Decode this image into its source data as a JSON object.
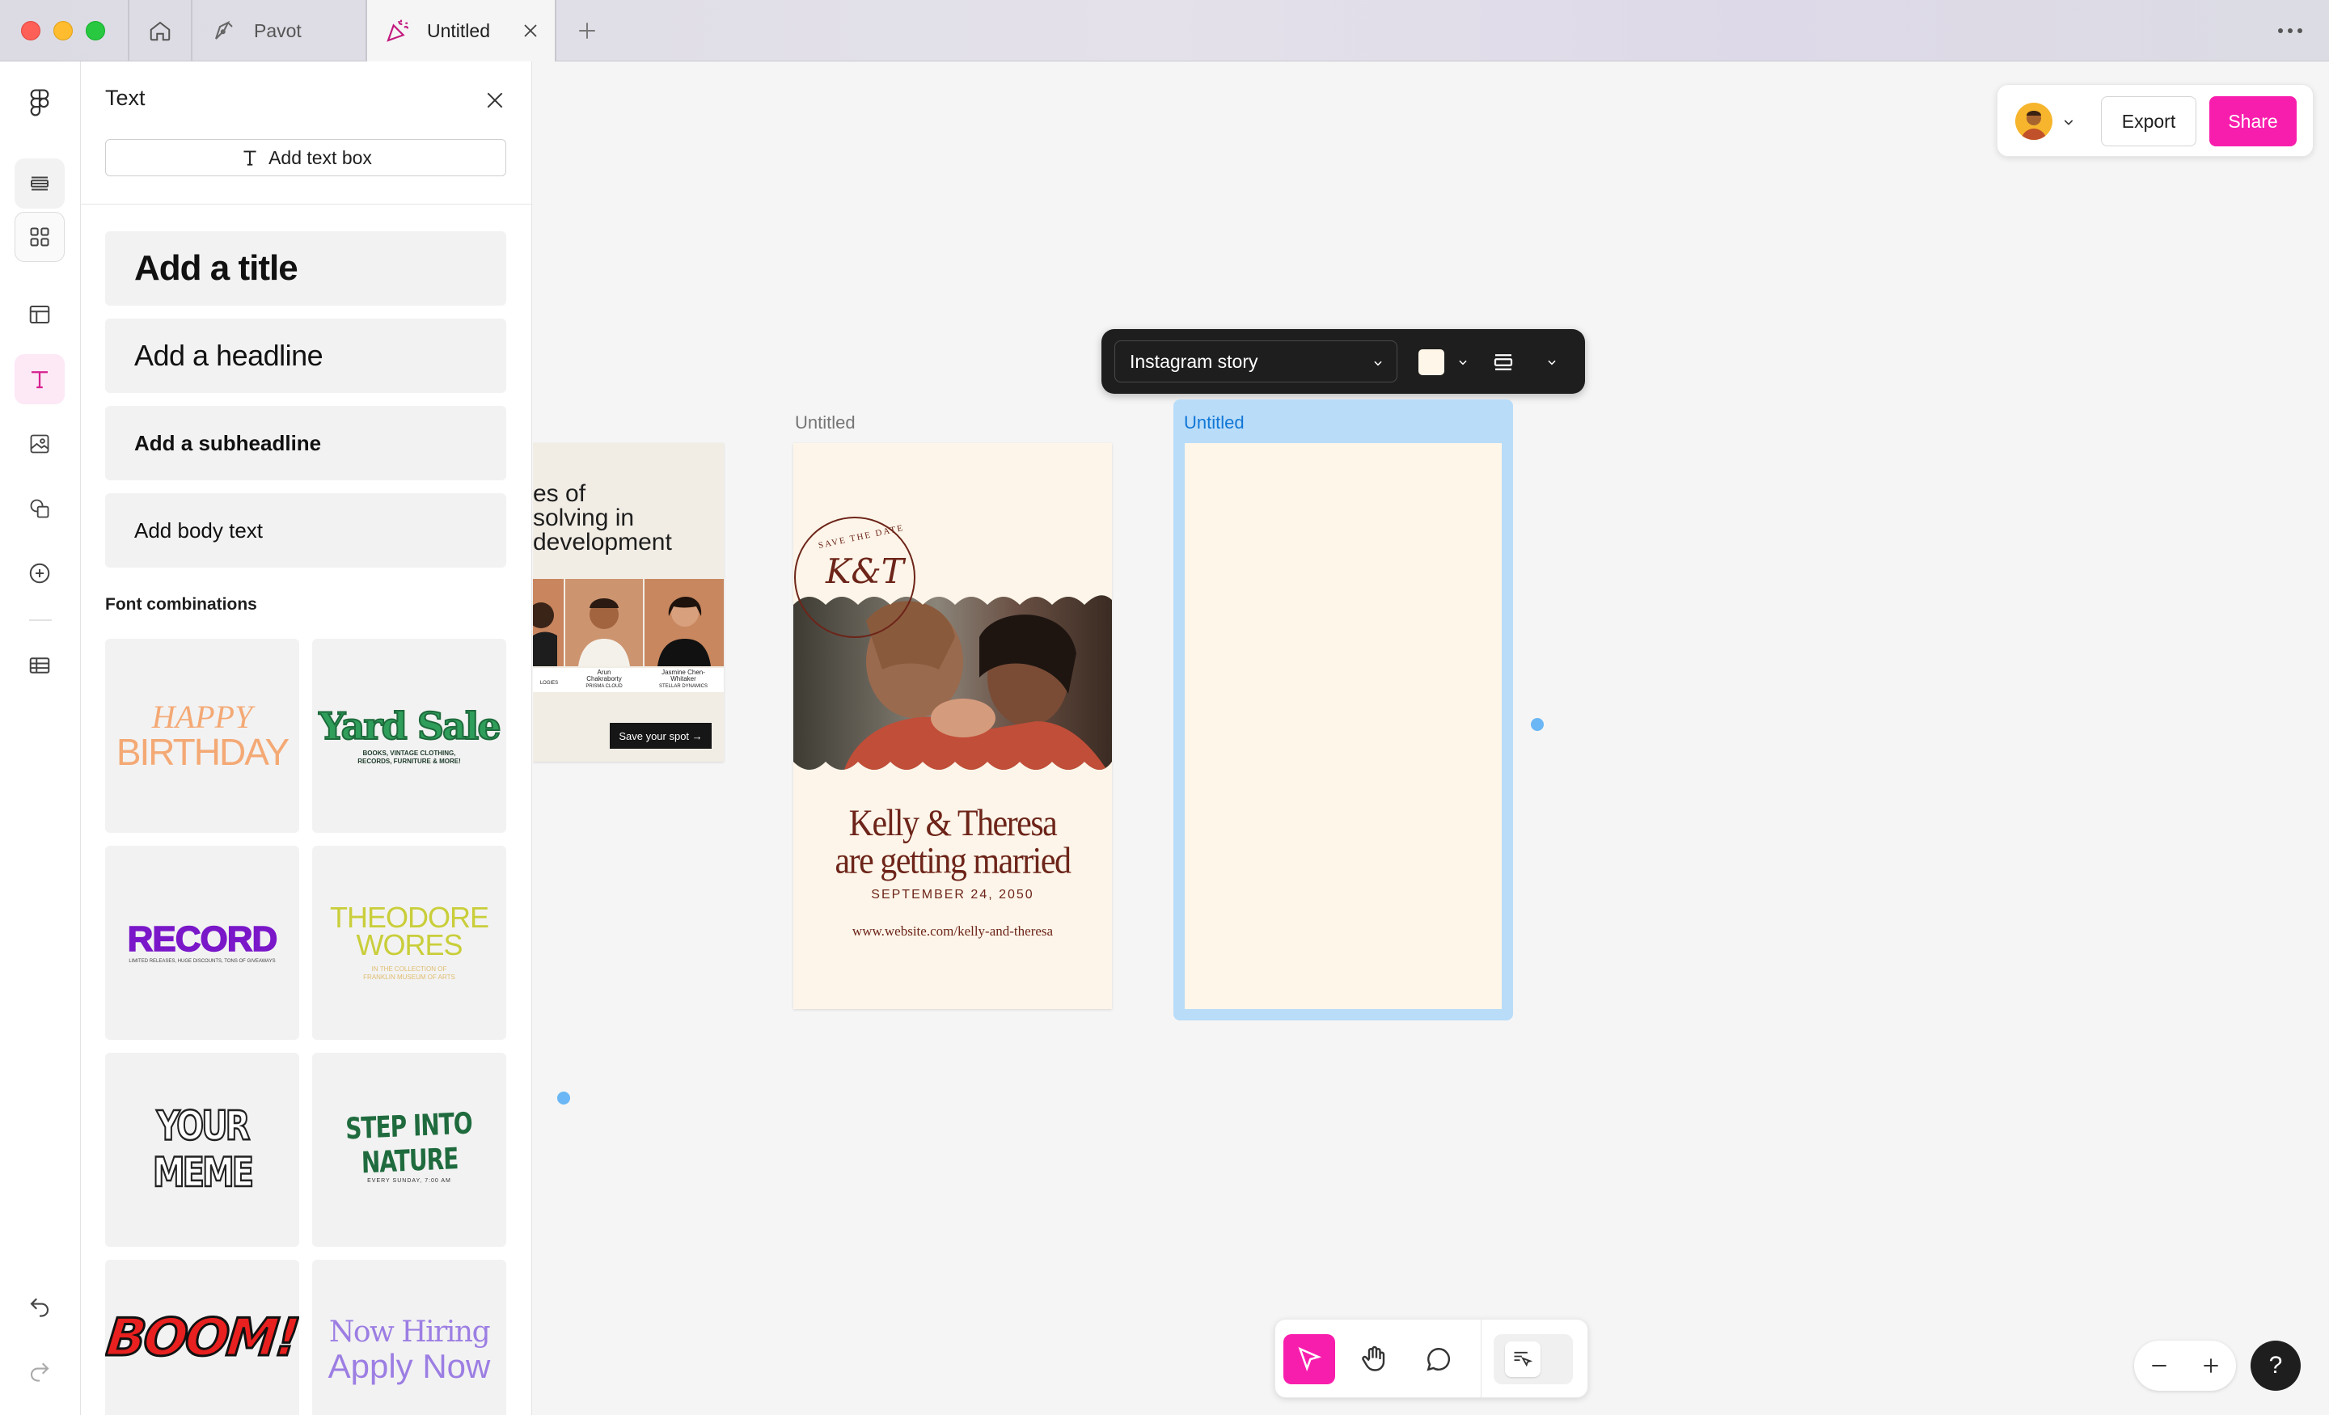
{
  "titlebar": {
    "tabs": [
      {
        "label": "Pavot",
        "icon": "pen-nib-icon"
      },
      {
        "label": "Untitled",
        "icon": "party-popper-icon",
        "active": true
      }
    ],
    "new_tab": "+",
    "more": "⋯"
  },
  "rail": {
    "items": [
      "figma-logo-icon",
      "layers-icon",
      "assets-icon",
      "templates-icon",
      "text-icon",
      "image-icon",
      "shapes-icon",
      "plus-circle-icon",
      "table-icon",
      "undo-icon",
      "redo-icon"
    ],
    "active": "text-icon"
  },
  "panel": {
    "title": "Text",
    "add_text_box": "Add text box",
    "presets": {
      "title": "Add a title",
      "headline": "Add a headline",
      "subheadline": "Add a subheadline",
      "body": "Add body text"
    },
    "font_combinations_label": "Font combinations",
    "combos": {
      "birthday_1": "HAPPY",
      "birthday_2": "BIRTHDAY",
      "yard_sale": "Yard Sale",
      "yard_sale_sub": "BOOKS, VINTAGE CLOTHING, RECORDS, FURNITURE & MORE!",
      "record": "RECORD",
      "record_sub": "LIMITED RELEASES, HUGE DISCOUNTS, TONS OF GIVEAWAYS",
      "theodore_1": "THEODORE",
      "theodore_2": "WORES",
      "theodore_sub1": "IN THE COLLECTION OF",
      "theodore_sub2": "FRANKLIN MUSEUM OF ARTS",
      "meme": "YOUR MEME",
      "nature": "STEP INTO NATURE",
      "nature_sub": "EVERY SUNDAY, 7:00 AM",
      "boom": "BOOM!",
      "hiring_1": "Now Hiring",
      "hiring_2": "Apply Now"
    }
  },
  "actions": {
    "export": "Export",
    "share": "Share",
    "share_color": "#f81ead"
  },
  "frame_toolbar": {
    "preset": "Instagram story",
    "swatch_color": "#fef6e8"
  },
  "frames": {
    "left": {
      "heading_1": "es of",
      "heading_2": "solving in",
      "heading_3": "development",
      "people": [
        {
          "name": "",
          "role": "LOGIES"
        },
        {
          "name": "Arun Chakraborty",
          "role": "PRISMA CLOUD"
        },
        {
          "name": "Jasmine Chen-Whitaker",
          "role": "STELLAR DYNAMICS"
        }
      ],
      "cta": "Save your spot →"
    },
    "wedding": {
      "label": "Untitled",
      "seal_top": "SAVE THE DATE",
      "monogram": "K&T",
      "names_1": "Kelly & Theresa",
      "names_2": "are getting married",
      "date": "SEPTEMBER 24, 2050",
      "url": "www.website.com/kelly-and-theresa"
    },
    "empty": {
      "label": "Untitled"
    }
  },
  "bottom_tools": [
    "move-tool-icon",
    "hand-tool-icon",
    "comment-tool-icon",
    "actions-tool-icon"
  ],
  "zoom": {
    "out": "−",
    "in": "+"
  },
  "help": "?"
}
